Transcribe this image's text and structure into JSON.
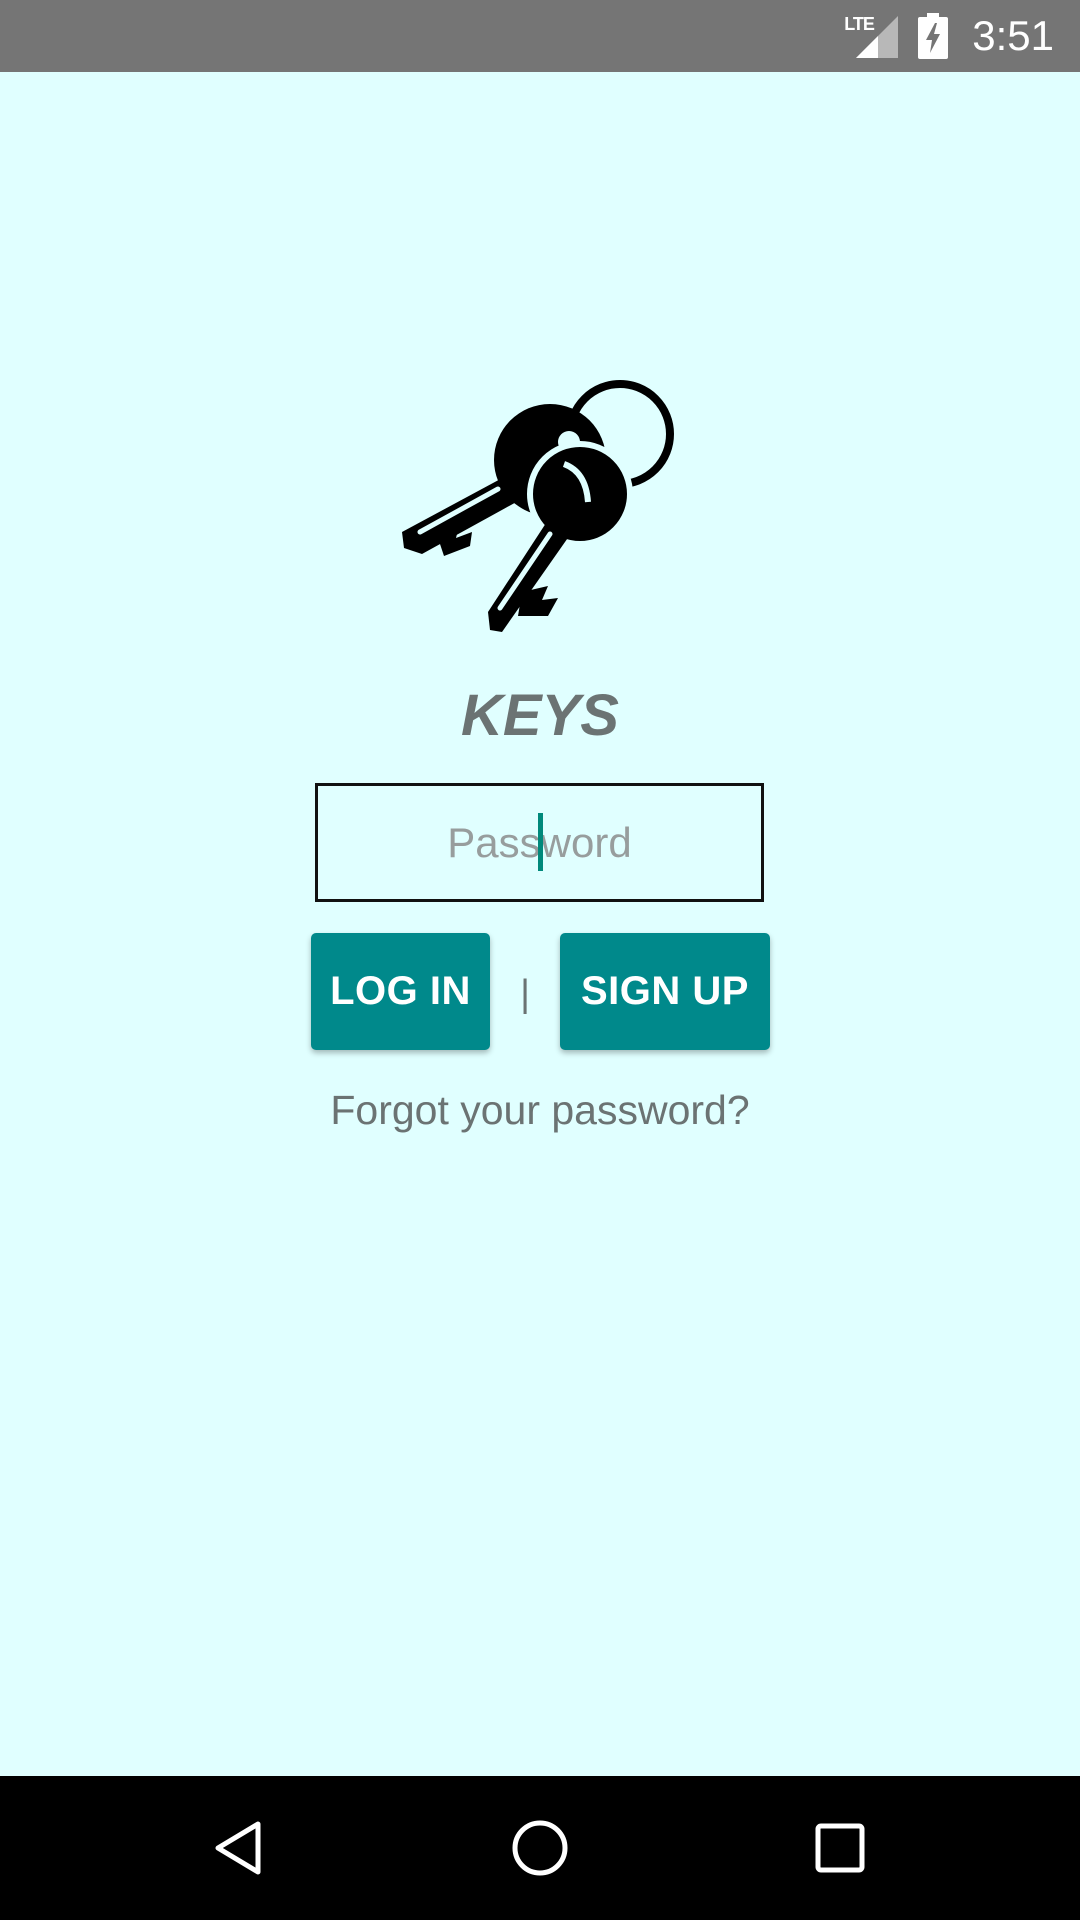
{
  "status_bar": {
    "network": "LTE",
    "time": "3:51",
    "icons": [
      "lte-signal-icon",
      "battery-charging-icon"
    ]
  },
  "app": {
    "logo_icon": "keys-icon",
    "title": "KEYS"
  },
  "password": {
    "placeholder": "Password",
    "value": ""
  },
  "actions": {
    "login_label": "LOG IN",
    "separator": "|",
    "signup_label": "SIGN UP",
    "forgot_label": "Forgot your password?"
  },
  "nav_bar": {
    "icons": [
      "back-icon",
      "home-icon",
      "recents-icon"
    ]
  },
  "colors": {
    "background": "#e0ffff",
    "status_bar": "#757575",
    "accent": "#00898b",
    "text_secondary": "#6b7373",
    "nav_bar": "#000000"
  }
}
